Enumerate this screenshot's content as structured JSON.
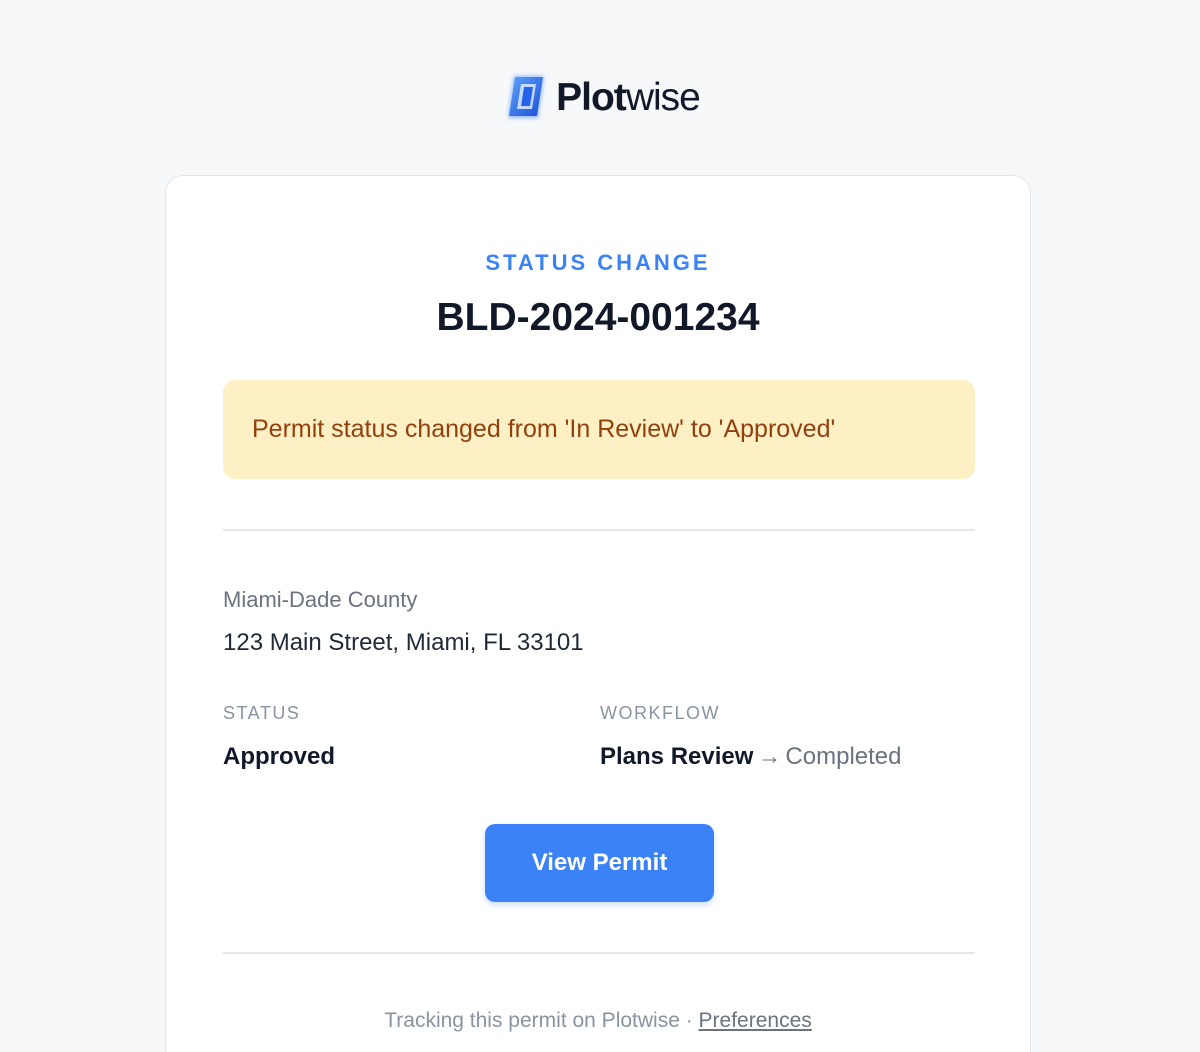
{
  "brand": {
    "name_bold": "Plot",
    "name_light": "wise",
    "logo_icon": "plotwise-logo-icon"
  },
  "email": {
    "eyebrow": "STATUS CHANGE",
    "permit_number": "BLD-2024-001234",
    "alert_message": "Permit status changed from 'In Review' to 'Approved'",
    "jurisdiction": "Miami-Dade County",
    "address": "123 Main Street, Miami, FL 33101",
    "status": {
      "label": "STATUS",
      "value": "Approved"
    },
    "workflow": {
      "label": "WORKFLOW",
      "step": "Plans Review",
      "arrow": "→",
      "next": "Completed"
    },
    "cta_label": "View Permit",
    "footer": {
      "text": "Tracking this permit on Plotwise · ",
      "link": "Preferences"
    }
  },
  "colors": {
    "accent": "#3b82f6",
    "alert_bg": "#fdf0c4",
    "alert_text": "#92400e",
    "page_bg": "#f7f8fa"
  }
}
